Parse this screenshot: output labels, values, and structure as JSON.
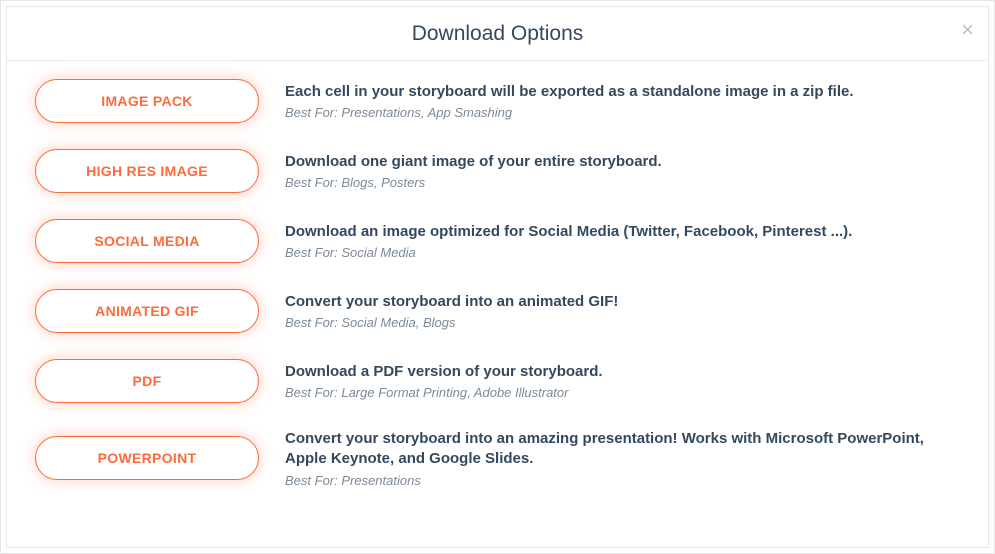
{
  "modal": {
    "title": "Download Options",
    "close_label": "×"
  },
  "options": [
    {
      "button": "IMAGE PACK",
      "title": "Each cell in your storyboard will be exported as a standalone image in a zip file.",
      "best_for": "Best For: Presentations, App Smashing"
    },
    {
      "button": "HIGH RES IMAGE",
      "title": "Download one giant image of your entire storyboard.",
      "best_for": "Best For: Blogs, Posters"
    },
    {
      "button": "SOCIAL MEDIA",
      "title": "Download an image optimized for Social Media (Twitter, Facebook, Pinterest ...).",
      "best_for": "Best For: Social Media"
    },
    {
      "button": "ANIMATED GIF",
      "title": "Convert your storyboard into an animated GIF!",
      "best_for": "Best For: Social Media, Blogs"
    },
    {
      "button": "PDF",
      "title": "Download a PDF version of your storyboard.",
      "best_for": "Best For: Large Format Printing, Adobe Illustrator"
    },
    {
      "button": "POWERPOINT",
      "title": "Convert your storyboard into an amazing presentation! Works with Microsoft PowerPoint, Apple Keynote, and Google Slides.",
      "best_for": "Best For: Presentations"
    }
  ]
}
